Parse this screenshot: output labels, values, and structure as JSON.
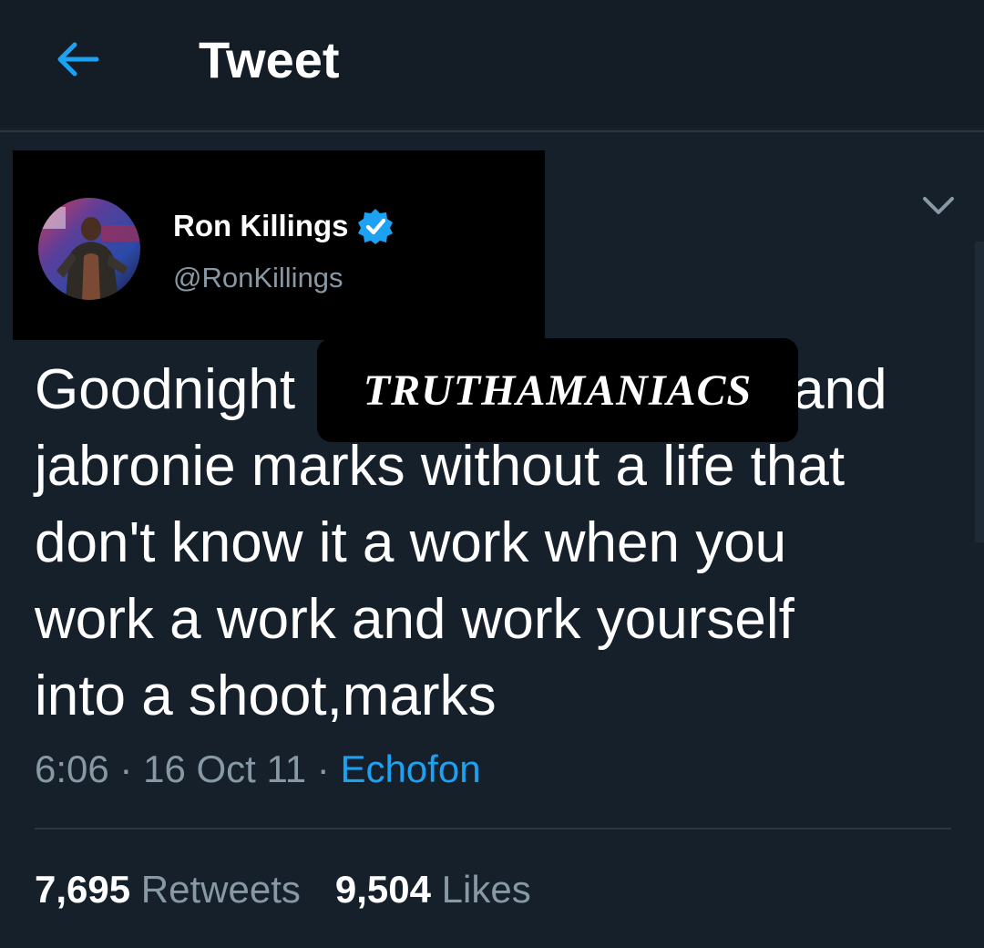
{
  "header": {
    "title": "Tweet",
    "back_icon": "arrow-left-icon",
    "accent_color": "#1da1f2"
  },
  "author": {
    "display_name": "Ron Killings",
    "handle": "@RonKillings",
    "verified": true,
    "verified_icon": "verified-badge-icon"
  },
  "tweet": {
    "lines": [
      [
        "Goodnight",
        "and"
      ],
      "jabronie marks without a life that",
      "don't know it a work when you",
      "work a work and work yourself",
      "into a shoot,marks"
    ],
    "watermark": "TRUTHAMANIACS",
    "time": "6:06",
    "separator": "·",
    "date": "16 Oct 11",
    "source": "Echofon"
  },
  "stats": {
    "retweets_count": "7,695",
    "retweets_label": "Retweets",
    "likes_count": "9,504",
    "likes_label": "Likes"
  },
  "colors": {
    "background": "#15202b",
    "text_secondary": "#8899a6",
    "link": "#1da1f2"
  }
}
